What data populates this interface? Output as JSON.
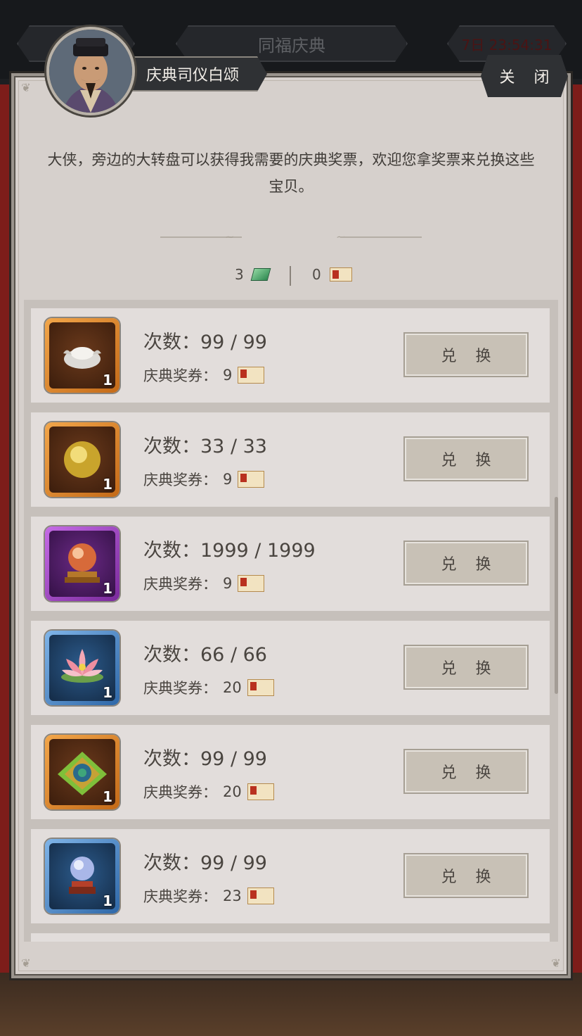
{
  "topbar": {
    "event_title": "同福庆典",
    "timer": "7日 23:54:31"
  },
  "header": {
    "npc_name": "庆典司仪白颂",
    "close_label": "关 闭"
  },
  "intro_text": "大侠，旁边的大转盘可以获得我需要的庆典奖票，欢迎您拿奖票来兑换这些宝贝。",
  "currency": {
    "jade_amount": "3",
    "coupon_amount": "0"
  },
  "labels": {
    "count_prefix": "次数：",
    "cost_prefix": "庆典奖券：",
    "exchange": "兑 换"
  },
  "items": [
    {
      "name": "silver-ingot",
      "frame": "orange",
      "count": "99 / 99",
      "cost": "9",
      "qty": "1"
    },
    {
      "name": "golden-orb",
      "frame": "orange",
      "count": "33 / 33",
      "cost": "9",
      "qty": "1"
    },
    {
      "name": "crystal-ball-stand",
      "frame": "purple",
      "count": "1999 / 1999",
      "cost": "9",
      "qty": "1"
    },
    {
      "name": "lotus-flower",
      "frame": "blue",
      "count": "66 / 66",
      "cost": "20",
      "qty": "1"
    },
    {
      "name": "jade-pendant",
      "frame": "orange",
      "count": "99 / 99",
      "cost": "20",
      "qty": "1"
    },
    {
      "name": "pearl-stand",
      "frame": "blue",
      "count": "99 / 99",
      "cost": "23",
      "qty": "1"
    }
  ]
}
